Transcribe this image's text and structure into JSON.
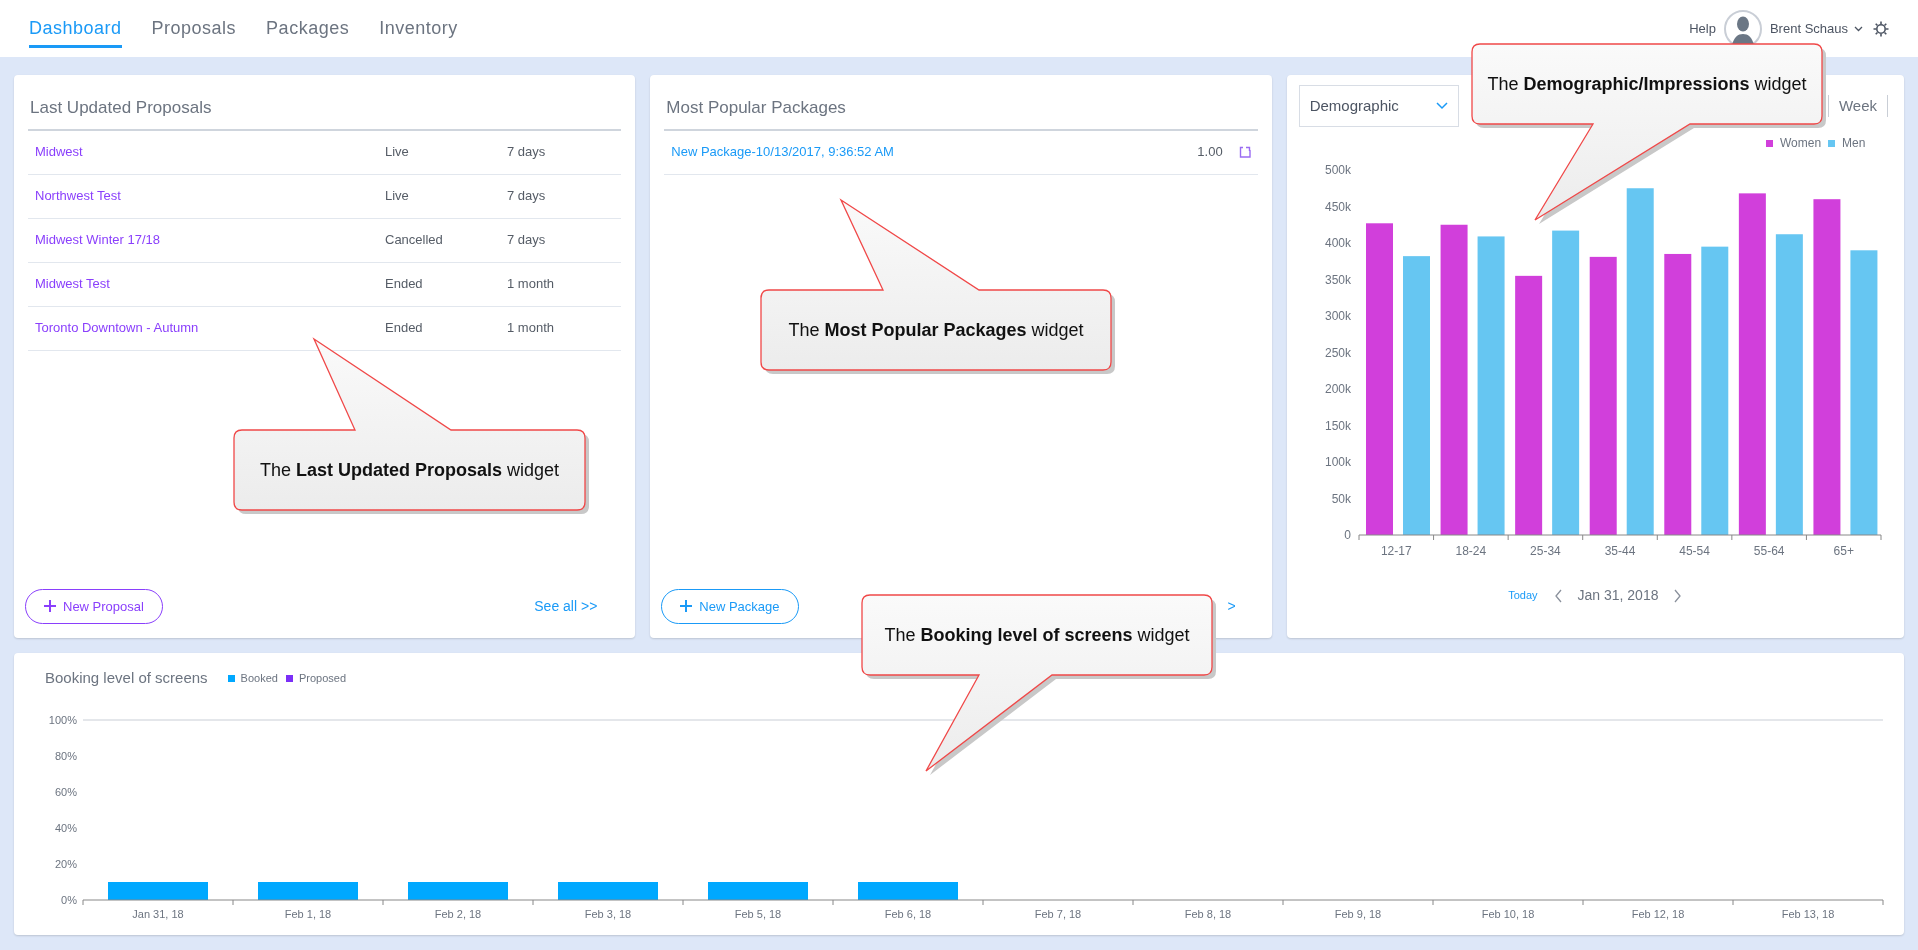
{
  "nav": {
    "tabs": [
      {
        "label": "Dashboard",
        "selected": true
      },
      {
        "label": "Proposals",
        "selected": false
      },
      {
        "label": "Packages",
        "selected": false
      },
      {
        "label": "Inventory",
        "selected": false
      }
    ],
    "help": "Help",
    "user": "Brent Schaus"
  },
  "proposals_widget": {
    "title": "Last Updated Proposals",
    "rows": [
      {
        "name": "Midwest",
        "status": "Live",
        "age": "7 days"
      },
      {
        "name": "Northwest Test",
        "status": "Live",
        "age": "7 days"
      },
      {
        "name": "Midwest Winter 17/18",
        "status": "Cancelled",
        "age": "7 days"
      },
      {
        "name": "Midwest Test",
        "status": "Ended",
        "age": "1 month"
      },
      {
        "name": "Toronto Downtown - Autumn",
        "status": "Ended",
        "age": "1 month"
      }
    ],
    "new_button": "New Proposal",
    "see_all": "See all >>"
  },
  "packages_widget": {
    "title": "Most Popular Packages",
    "rows": [
      {
        "name": "New Package-10/13/2017, 9:36:52 AM",
        "value": "1.00"
      }
    ],
    "new_button": "New Package",
    "see_all": ">"
  },
  "demographic_widget": {
    "dropdown": "Demographic",
    "period_tab": "Week",
    "today": "Today",
    "date": "Jan 31, 2018",
    "chart_data": {
      "type": "bar",
      "legend": "top-right",
      "categories": [
        "12-17",
        "18-24",
        "25-34",
        "35-44",
        "45-54",
        "55-64",
        "65+"
      ],
      "series": [
        {
          "name": "Women",
          "color": "#d13fdb",
          "values": [
            427000,
            425000,
            355000,
            381000,
            385000,
            468000,
            460000
          ]
        },
        {
          "name": "Men",
          "color": "#66c6f2",
          "values": [
            382000,
            409000,
            417000,
            475000,
            395000,
            412000,
            390000
          ]
        }
      ],
      "ylim": [
        0,
        500000
      ],
      "yticks": [
        {
          "value": 0,
          "label": "0"
        },
        {
          "value": 50000,
          "label": "50k"
        },
        {
          "value": 100000,
          "label": "100k"
        },
        {
          "value": 150000,
          "label": "150k"
        },
        {
          "value": 200000,
          "label": "200k"
        },
        {
          "value": 250000,
          "label": "250k"
        },
        {
          "value": 300000,
          "label": "300k"
        },
        {
          "value": 350000,
          "label": "350k"
        },
        {
          "value": 400000,
          "label": "400k"
        },
        {
          "value": 450000,
          "label": "450k"
        },
        {
          "value": 500000,
          "label": "500k"
        }
      ]
    }
  },
  "booking_widget": {
    "title": "Booking level of screens",
    "chart_data": {
      "type": "bar",
      "stacked": true,
      "categories": [
        "Jan 31, 18",
        "Feb 1, 18",
        "Feb 2, 18",
        "Feb 3, 18",
        "Feb 5, 18",
        "Feb 6, 18",
        "Feb 7, 18",
        "Feb 8, 18",
        "Feb 9, 18",
        "Feb 10, 18",
        "Feb 12, 18",
        "Feb 13, 18"
      ],
      "series": [
        {
          "name": "Booked",
          "color": "#00a8ff",
          "values": [
            10,
            10,
            10,
            10,
            10,
            10,
            0,
            0,
            0,
            0,
            0,
            0
          ]
        },
        {
          "name": "Proposed",
          "color": "#7b2ff7",
          "values": [
            0,
            0,
            0,
            0,
            0,
            0,
            0,
            0,
            0,
            0,
            0,
            0
          ]
        }
      ],
      "ylim": [
        0,
        100
      ],
      "yticks": [
        {
          "value": 0,
          "label": "0%"
        },
        {
          "value": 20,
          "label": "20%"
        },
        {
          "value": 40,
          "label": "40%"
        },
        {
          "value": 60,
          "label": "60%"
        },
        {
          "value": 80,
          "label": "80%"
        },
        {
          "value": 100,
          "label": "100%"
        }
      ]
    }
  },
  "callouts": [
    {
      "text": "The **Last Updated Proposals** widget"
    },
    {
      "text": "The **Most Popular Packages** widget"
    },
    {
      "text": "The **Demographic/Impressions** widget"
    },
    {
      "text": "The **Booking level of screens** widget"
    }
  ]
}
